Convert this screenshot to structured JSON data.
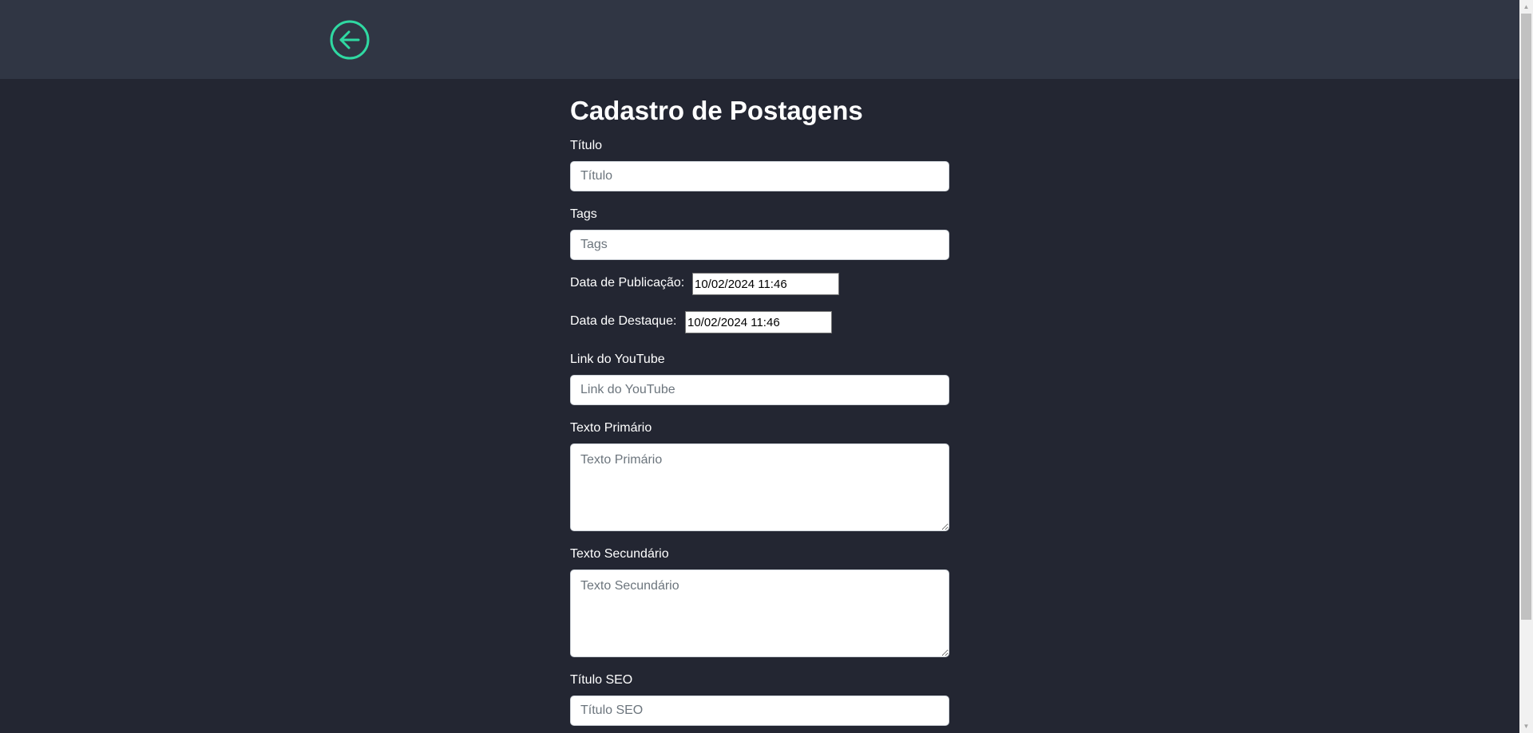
{
  "header": {
    "back_icon": "arrow-left-circle-icon",
    "accent_color": "#2fd9a2"
  },
  "form": {
    "heading": "Cadastro de Postagens",
    "titulo": {
      "label": "Título",
      "placeholder": "Título",
      "value": ""
    },
    "tags": {
      "label": "Tags",
      "placeholder": "Tags",
      "value": ""
    },
    "data_publicacao": {
      "label": "Data de Publicação:",
      "value": "10/02/2024 11:46"
    },
    "data_destaque": {
      "label": "Data de Destaque:",
      "value": "10/02/2024 11:46"
    },
    "youtube": {
      "label": "Link do YouTube",
      "placeholder": "Link do YouTube",
      "value": ""
    },
    "texto_primario": {
      "label": "Texto Primário",
      "placeholder": "Texto Primário",
      "value": ""
    },
    "texto_secundario": {
      "label": "Texto Secundário",
      "placeholder": "Texto Secundário",
      "value": ""
    },
    "titulo_seo": {
      "label": "Título SEO",
      "placeholder": "Título SEO",
      "value": ""
    }
  }
}
